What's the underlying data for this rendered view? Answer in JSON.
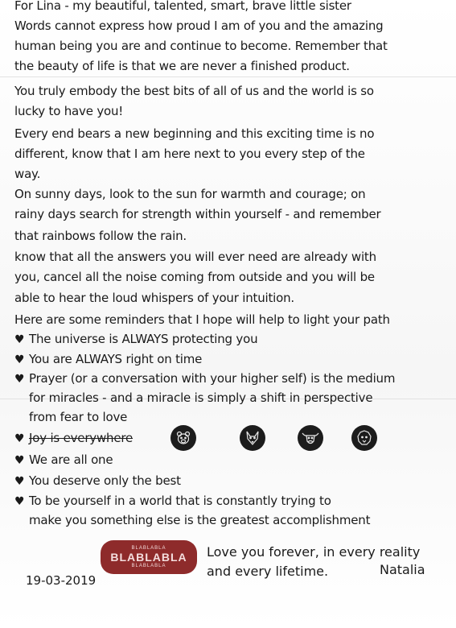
{
  "letter": {
    "lines": [
      "For Lina - my beautiful, talented, smart, brave little sister",
      "Words cannot express how proud I am of you and the amazing",
      "human being you are and continue to become. Remember that",
      "the beauty of life is that we are never a finished product.",
      "You truly embody the best bits of all of us and the world is so",
      "lucky to have you!",
      "Every end bears a new beginning and this exciting time is no",
      "different, know that I am here next to you every step of the",
      "way.",
      "On sunny days, look to the sun for warmth and courage; on",
      "rainy days search for strength within yourself - and remember",
      "that rainbows follow the rain.",
      "know that all the answers you will ever need are already with",
      "you, cancel all the noise coming from outside and you will be",
      "able to hear the loud whispers of your intuition.",
      "Here are some reminders that I hope will help to light your path"
    ],
    "reminders": [
      "The universe is ALWAYS protecting you",
      "You are ALWAYS right on time",
      "Prayer (or a conversation with your higher self) is the medium",
      "for miracles - and a miracle is simply a shift in perspective",
      "from fear to love",
      "Joy is everywhere",
      "We are all one",
      "You deserve only the best",
      "To be yourself in a world that is constantly trying to",
      "make you something else is the greatest accomplishment"
    ],
    "closing_line1": "Love you forever, in every reality",
    "closing_line2": "and every lifetime.",
    "signature": "Natalia",
    "date": "19-03-2019"
  },
  "stamp": {
    "top": "BLABLABLA",
    "main": "BLABLABLA",
    "bottom": "BLABLABLA",
    "color": "#8e2b2b"
  },
  "icons": [
    "bear-face-icon",
    "wolf-face-icon",
    "bull-face-icon",
    "lion-face-icon"
  ],
  "colors": {
    "ink": "#1a1a1a",
    "paper": "#fbfbfb",
    "icon_fill": "#1c1c1c"
  }
}
